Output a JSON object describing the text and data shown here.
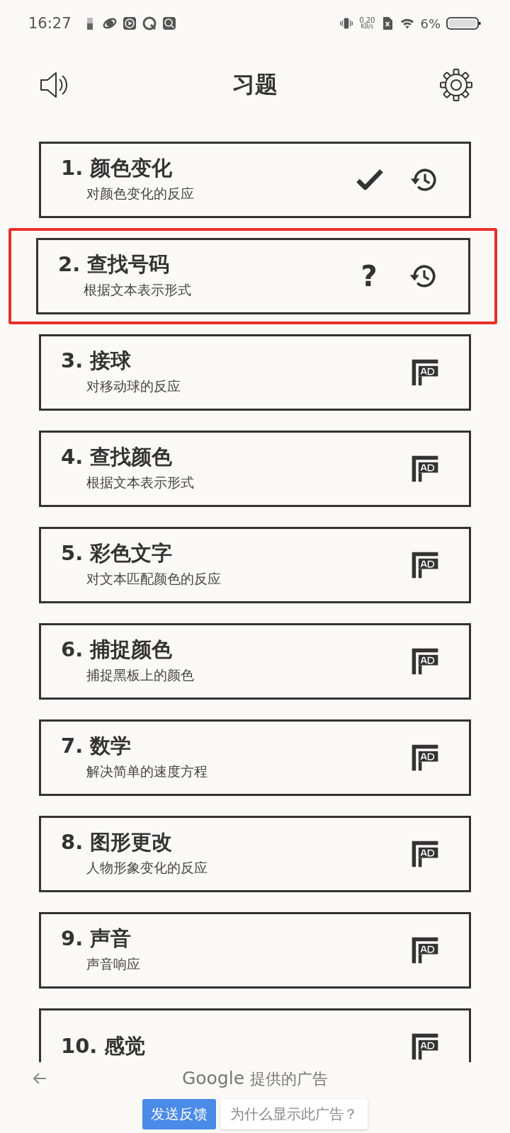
{
  "status_bar": {
    "time": "16:27",
    "speed": "0.20",
    "speed_unit": "KB/s",
    "battery": "6%"
  },
  "header": {
    "title": "习题"
  },
  "exercises": [
    {
      "title": "1. 颜色变化",
      "subtitle": "对颜色变化的反应",
      "kind": "done",
      "highlighted": false
    },
    {
      "title": "2. 查找号码",
      "subtitle": "根据文本表示形式",
      "kind": "unknown",
      "status_glyph": "?",
      "highlighted": true
    },
    {
      "title": "3. 接球",
      "subtitle": "对移动球的反应",
      "kind": "ad",
      "highlighted": false
    },
    {
      "title": "4. 查找颜色",
      "subtitle": "根据文本表示形式",
      "kind": "ad",
      "highlighted": false
    },
    {
      "title": "5. 彩色文字",
      "subtitle": "对文本匹配颜色的反应",
      "kind": "ad",
      "highlighted": false
    },
    {
      "title": "6. 捕捉颜色",
      "subtitle": "捕捉黑板上的颜色",
      "kind": "ad",
      "highlighted": false
    },
    {
      "title": "7. 数学",
      "subtitle": "解决简单的速度方程",
      "kind": "ad",
      "highlighted": false
    },
    {
      "title": "8. 图形更改",
      "subtitle": "人物形象变化的反应",
      "kind": "ad",
      "highlighted": false
    },
    {
      "title": "9. 声音",
      "subtitle": "声音响应",
      "kind": "ad",
      "highlighted": false
    },
    {
      "title": "10. 感觉",
      "kind": "ad",
      "highlighted": false
    }
  ],
  "ad_bar": {
    "brand": "Google",
    "label": "提供的广告",
    "feedback_button": "发送反馈",
    "why_link": "为什么显示此广告？"
  }
}
